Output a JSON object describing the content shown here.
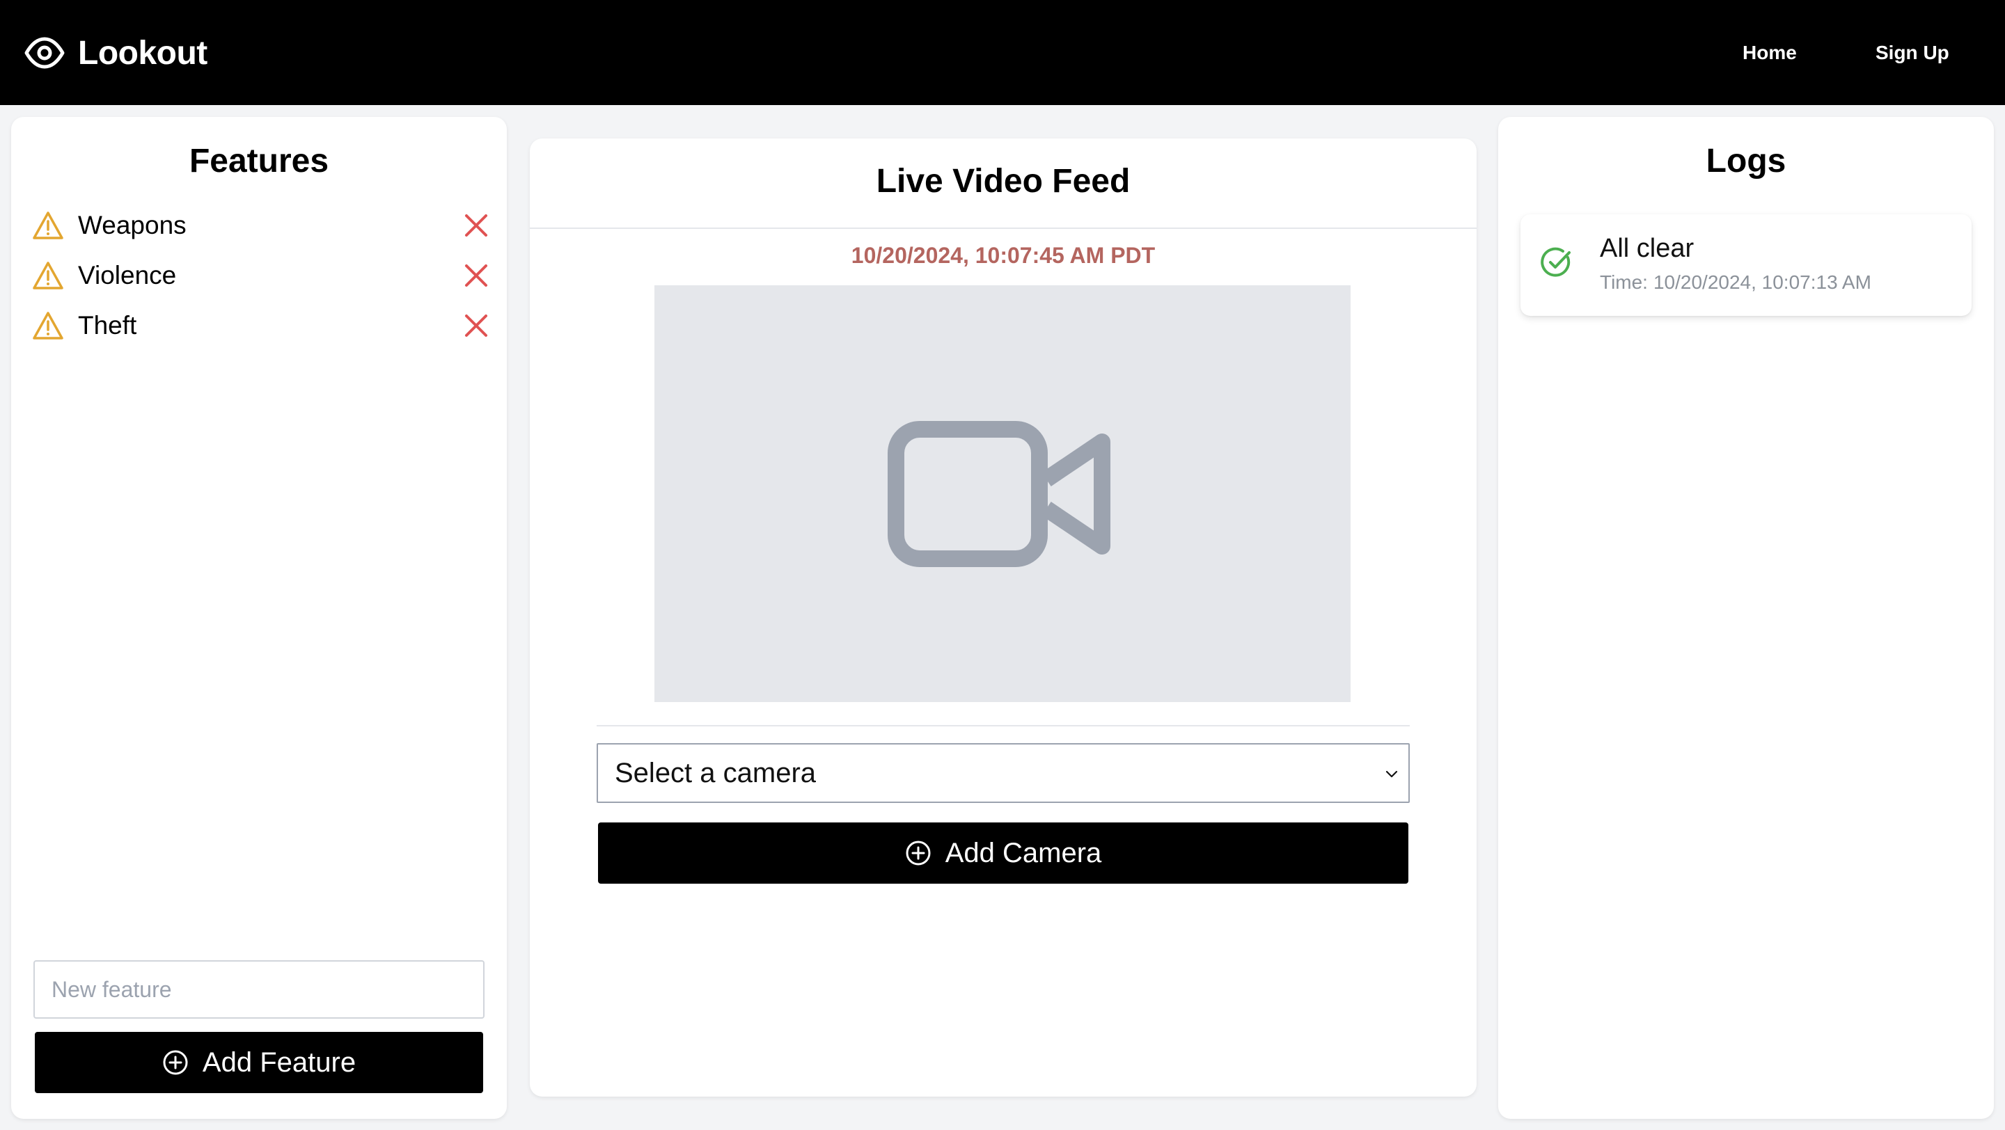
{
  "header": {
    "brand": "Lookout",
    "nav": {
      "home": "Home",
      "signup": "Sign Up"
    }
  },
  "features": {
    "title": "Features",
    "items": [
      {
        "label": "Weapons"
      },
      {
        "label": "Violence"
      },
      {
        "label": "Theft"
      }
    ],
    "input_placeholder": "New feature",
    "add_label": "Add Feature"
  },
  "video": {
    "title": "Live Video Feed",
    "timestamp": "10/20/2024, 10:07:45 AM PDT",
    "camera_select": {
      "selected": "Select a camera"
    },
    "add_camera_label": "Add Camera"
  },
  "logs": {
    "title": "Logs",
    "entries": [
      {
        "title": "All clear",
        "time_prefix": "Time:",
        "time": "10/20/2024, 10:07:13 AM",
        "status_color": "#4caf50"
      }
    ]
  },
  "colors": {
    "warning": "#e3a630",
    "delete": "#e05252",
    "timestamp": "#b4655f",
    "success": "#4caf50",
    "placeholder_bg": "#e5e7eb",
    "placeholder_icon": "#9ca3af"
  },
  "icons": {
    "brand": "eye-icon",
    "feature": "warning-triangle-icon",
    "delete": "close-x-icon",
    "video": "video-camera-icon",
    "add": "plus-circle-icon",
    "select": "chevron-down-icon",
    "log_status": "check-circle-icon"
  }
}
